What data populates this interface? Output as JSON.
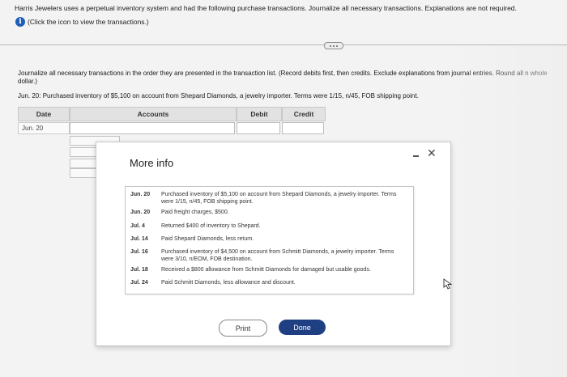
{
  "header": {
    "problem_text": "Harris Jewelers uses a perpetual inventory system and had the following purchase transactions. Journalize all necessary transactions. Explanations are not required.",
    "click_note": "(Click the icon to view the transactions.)"
  },
  "instructions": "Journalize all necessary transactions in the order they are presented in the transaction list. (Record debits first, then credits. Exclude explanations from journal entries. Round all n whole dollar.)",
  "transaction_line": "Jun. 20: Purchased inventory of $5,100 on account from Shepard Diamonds, a jewelry importer. Terms were 1/15, n/45, FOB shipping point.",
  "journal": {
    "headers": {
      "date": "Date",
      "accounts": "Accounts",
      "debit": "Debit",
      "credit": "Credit"
    },
    "row_date": "Jun. 20"
  },
  "modal": {
    "title": "More info",
    "rows": [
      {
        "date": "Jun. 20",
        "text": "Purchased inventory of $5,100 on account from Shepard Diamonds, a jewelry importer. Terms were 1/15, n/45, FOB shipping point."
      },
      {
        "date": "Jun. 20",
        "text": "Paid freight charges, $500."
      },
      {
        "date": "Jul. 4",
        "text": "Returned $400 of inventory to Shepard."
      },
      {
        "date": "Jul. 14",
        "text": "Paid Shepard Diamonds, less return."
      },
      {
        "date": "Jul. 16",
        "text": "Purchased inventory of $4,500 on account from Schmitt Diamonds, a jewelry importer. Terms were 3/10, n/EOM, FOB destination."
      },
      {
        "date": "Jul. 18",
        "text": "Received a $800 allowance from Schmitt Diamonds for damaged but usable goods."
      },
      {
        "date": "Jul. 24",
        "text": "Paid Schmitt Diamonds, less allowance and discount."
      }
    ],
    "print_label": "Print",
    "done_label": "Done"
  },
  "colors": {
    "info_icon": "#1d5fb5",
    "done_button": "#1f3f83"
  }
}
